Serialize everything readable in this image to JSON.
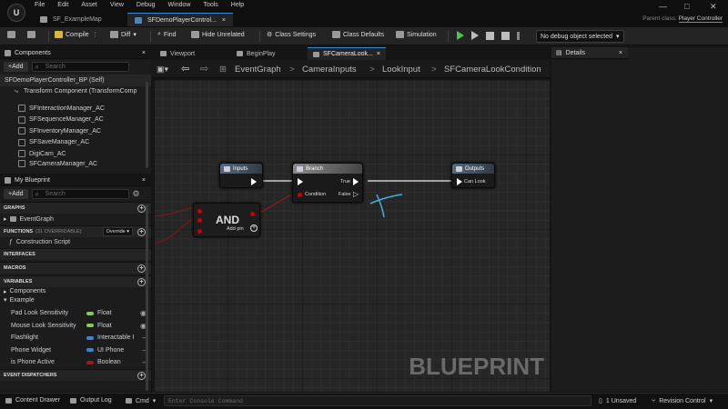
{
  "app": {
    "logo": "U",
    "menu": [
      "File",
      "Edit",
      "Asset",
      "View",
      "Debug",
      "Window",
      "Tools",
      "Help"
    ],
    "doc_tabs": [
      {
        "label": "SF_ExampleMap",
        "icon": "map-icon"
      },
      {
        "label": "SFDemoPlayerControl...",
        "icon": "blueprint-icon",
        "close": "×"
      }
    ],
    "parent_class_label": "Parent class:",
    "parent_class_value": "Player Controller",
    "window_controls": [
      "—",
      "□",
      "✕"
    ]
  },
  "toolbar": {
    "compile": "Compile",
    "diff": "Diff",
    "find": "Find",
    "hide_unrelated": "Hide Unrelated",
    "class_settings": "Class Settings",
    "class_defaults": "Class Defaults",
    "simulation": "Simulation",
    "debug_select": "No debug object selected"
  },
  "components": {
    "tab": "Components",
    "add": "+Add",
    "search_placeholder": "Search",
    "root": "SFDemoPlayerController_BP (Self)",
    "transform": "Transform Component (TransformComp",
    "items": [
      "SFInteractionManager_AC",
      "SFSequenceManager_AC",
      "SFInventoryManager_AC",
      "SFSaveManager_AC",
      "DigiCam_AC",
      "SFCameraManager_AC"
    ]
  },
  "my_blueprint": {
    "tab": "My Blueprint",
    "add": "+Add",
    "search_placeholder": "Search",
    "sections": {
      "graphs": "GRAPHS",
      "event_graph": "EventGraph",
      "functions": "FUNCTIONS",
      "functions_count": "(31 OVERRIDABLE)",
      "override": "Override",
      "construction": "Construction Script",
      "interfaces": "INTERFACES",
      "macros": "MACROS",
      "variables": "VARIABLES",
      "components": "Components",
      "example": "Example",
      "event_dispatchers": "EVENT DISPATCHERS"
    },
    "variables": [
      {
        "name": "Pad Look Sensitivity",
        "type": "Float",
        "color": "#7fd14a",
        "eye": "◉"
      },
      {
        "name": "Mouse Look Sensitivity",
        "type": "Float",
        "color": "#7fd14a",
        "eye": "◉"
      },
      {
        "name": "Flashlight",
        "type": "Interactable I",
        "color": "#4a7fd8",
        "eye": "‒"
      },
      {
        "name": "Phone Widget",
        "type": "UI Phone",
        "color": "#3a7fd8",
        "eye": "‒"
      },
      {
        "name": "is Phone Active",
        "type": "Boolean",
        "color": "#9b1a1a",
        "eye": "‒"
      }
    ]
  },
  "graph": {
    "tabs": [
      "Viewport",
      "BeginPlay",
      "SFCameraLook..."
    ],
    "breadcrumb": [
      "EventGraph",
      "CameraInputs",
      "LookInput",
      "SFCameraLookCondition"
    ],
    "separator": ">",
    "nodes": {
      "inputs": "Inputs",
      "branch": "Branch",
      "true": "True",
      "false": "False",
      "condition": "Condition",
      "outputs": "Outputs",
      "can_look": "Can Look",
      "and": "AND",
      "add_pin": "Add pin"
    },
    "watermark": "BLUEPRINT"
  },
  "details": {
    "tab": "Details"
  },
  "bottom": {
    "content_drawer": "Content Drawer",
    "output_log": "Output Log",
    "cmd": "Cmd",
    "console_placeholder": "Enter Console Command",
    "unsaved": "1 Unsaved",
    "revision": "Revision Control"
  }
}
